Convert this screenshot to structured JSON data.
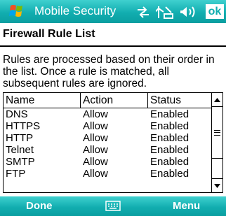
{
  "titlebar": {
    "app_title": "Mobile Security",
    "ok_label": "ok",
    "icons": [
      "windows-logo-icon",
      "connectivity-icon",
      "signal-icon",
      "volume-icon"
    ]
  },
  "page": {
    "title": "Firewall Rule List",
    "description": "Rules are processed based on their order in the list. Once a rule is matched, all subsequent rules are ignored."
  },
  "table": {
    "columns": [
      "Name",
      "Action",
      "Status"
    ],
    "rows": [
      {
        "name": "DNS",
        "action": "Allow",
        "status": "Enabled"
      },
      {
        "name": "HTTPS",
        "action": "Allow",
        "status": "Enabled"
      },
      {
        "name": "HTTP",
        "action": "Allow",
        "status": "Enabled"
      },
      {
        "name": "Telnet",
        "action": "Allow",
        "status": "Enabled"
      },
      {
        "name": "SMTP",
        "action": "Allow",
        "status": "Enabled"
      },
      {
        "name": "FTP",
        "action": "Allow",
        "status": "Enabled"
      }
    ]
  },
  "softkeys": {
    "left": "Done",
    "right": "Menu",
    "center_icon": "keyboard-icon"
  },
  "colors": {
    "accent": "#12aeb0",
    "bar_light": "#3fd0cf",
    "text": "#000000",
    "background": "#ffffff"
  }
}
